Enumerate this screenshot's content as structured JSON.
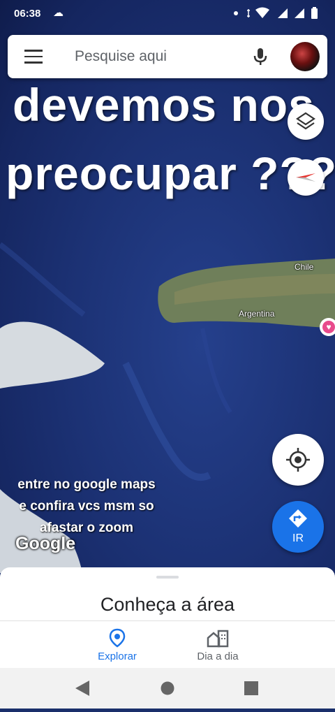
{
  "status_bar": {
    "time": "06:38"
  },
  "search": {
    "placeholder": "Pesquise aqui"
  },
  "overlay": {
    "line1": "devemos nos",
    "line2": "preocupar ???",
    "caption_lines": [
      "entre no google maps",
      "e confira vcs msm so",
      "afastar o zoom"
    ]
  },
  "map": {
    "labels": {
      "chile": "Chile",
      "argentina": "Argentina"
    },
    "logo": "Google"
  },
  "buttons": {
    "go_label": "IR"
  },
  "sheet": {
    "title": "Conheça a área"
  },
  "bottom_nav": {
    "explore": "Explorar",
    "daily": "Dia a dia"
  },
  "colors": {
    "accent": "#1a73e8",
    "ocean": "#1c3275",
    "land": "#6f7f5a"
  }
}
